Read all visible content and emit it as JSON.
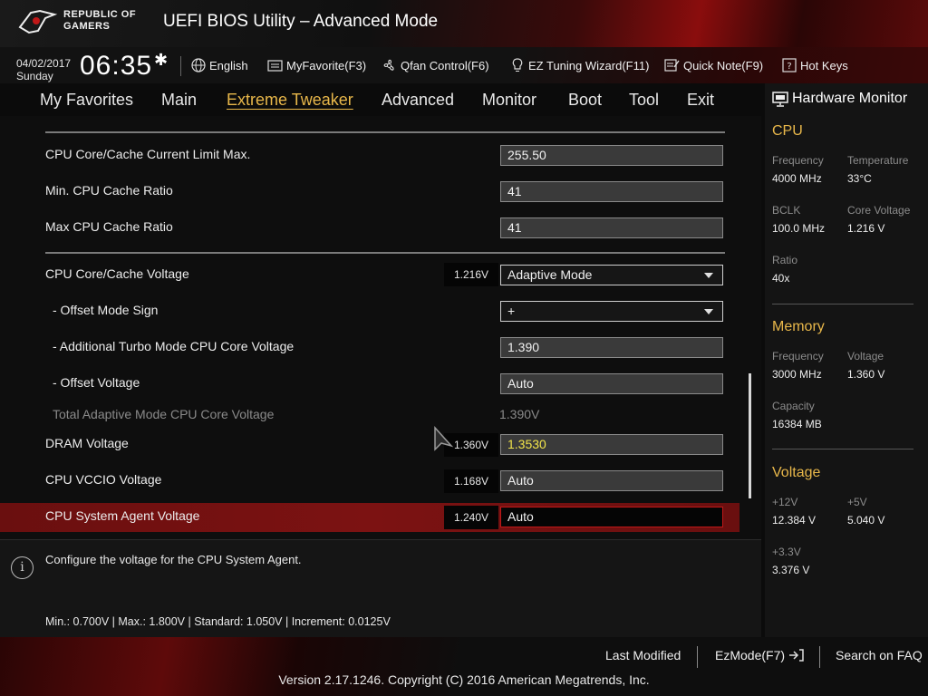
{
  "header": {
    "brand_line1": "REPUBLIC OF",
    "brand_line2": "GAMERS",
    "title": "UEFI BIOS Utility – Advanced Mode"
  },
  "infobar": {
    "date": "04/02/2017",
    "day": "Sunday",
    "time": "06:35",
    "tools": {
      "language": "English",
      "myfavorite": "MyFavorite(F3)",
      "qfan": "Qfan Control(F6)",
      "ez_tuning": "EZ Tuning Wizard(F11)",
      "quick_note": "Quick Note(F9)",
      "hot_keys": "Hot Keys"
    }
  },
  "nav": {
    "active": "Extreme Tweaker",
    "tabs": [
      "My Favorites",
      "Main",
      "Extreme Tweaker",
      "Advanced",
      "Monitor",
      "Boot",
      "Tool",
      "Exit"
    ]
  },
  "settings": {
    "current_limit": {
      "label": "CPU Core/Cache Current Limit Max.",
      "value": "255.50"
    },
    "min_cache_ratio": {
      "label": "Min. CPU Cache Ratio",
      "value": "41"
    },
    "max_cache_ratio": {
      "label": "Max CPU Cache Ratio",
      "value": "41"
    },
    "core_cache_voltage": {
      "label": "CPU Core/Cache Voltage",
      "reading": "1.216V",
      "value": "Adaptive Mode"
    },
    "offset_sign": {
      "label": "- Offset Mode Sign",
      "value": "+"
    },
    "turbo_voltage": {
      "label": "- Additional Turbo Mode CPU Core Voltage",
      "value": "1.390"
    },
    "offset_voltage": {
      "label": "- Offset Voltage",
      "value": "Auto"
    },
    "total_adaptive": {
      "label": "Total Adaptive Mode CPU Core Voltage",
      "value": "1.390V"
    },
    "dram_voltage": {
      "label": "DRAM Voltage",
      "reading": "1.360V",
      "value": "1.3530"
    },
    "vccio_voltage": {
      "label": "CPU VCCIO Voltage",
      "reading": "1.168V",
      "value": "Auto"
    },
    "sa_voltage": {
      "label": "CPU System Agent Voltage",
      "reading": "1.240V",
      "value": "Auto"
    }
  },
  "help": {
    "text": "Configure the voltage for the CPU System Agent.",
    "range": "Min.: 0.700V   |   Max.: 1.800V   |   Standard: 1.050V   |   Increment: 0.0125V"
  },
  "hw_monitor": {
    "title": "Hardware Monitor",
    "cpu": {
      "heading": "CPU",
      "frequency_label": "Frequency",
      "frequency": "4000 MHz",
      "temperature_label": "Temperature",
      "temperature": "33°C",
      "bclk_label": "BCLK",
      "bclk": "100.0 MHz",
      "core_voltage_label": "Core Voltage",
      "core_voltage": "1.216 V",
      "ratio_label": "Ratio",
      "ratio": "40x"
    },
    "memory": {
      "heading": "Memory",
      "frequency_label": "Frequency",
      "frequency": "3000 MHz",
      "voltage_label": "Voltage",
      "voltage": "1.360 V",
      "capacity_label": "Capacity",
      "capacity": "16384 MB"
    },
    "voltage": {
      "heading": "Voltage",
      "v12_label": "+12V",
      "v12": "12.384 V",
      "v5_label": "+5V",
      "v5": "5.040 V",
      "v33_label": "+3.3V",
      "v33": "3.376 V"
    }
  },
  "footer": {
    "last_modified": "Last Modified",
    "ezmode": "EzMode(F7)",
    "search_faq": "Search on FAQ",
    "copyright": "Version 2.17.1246. Copyright (C) 2016 American Megatrends, Inc."
  },
  "colors": {
    "accent": "#e8b74a",
    "highlight_row": "#7c1212",
    "yellow_value": "#f2e44a"
  }
}
